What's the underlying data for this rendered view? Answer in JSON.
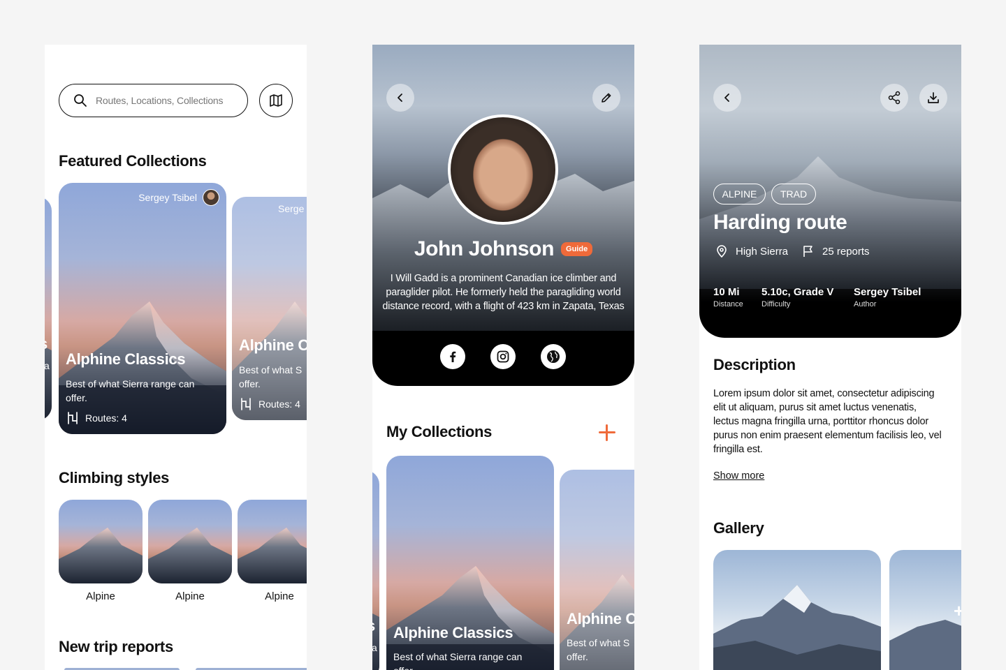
{
  "screen1": {
    "search_placeholder": "Routes, Locations, Collections",
    "featured_title": "Featured Collections",
    "featured_cards": [
      {
        "author": "Sergey Tsibel",
        "title": "Alphine Classics",
        "desc": "Best of what Sierra range can offer.",
        "routes": "Routes: 4"
      },
      {
        "author": "Serge",
        "title": "Alphine C",
        "desc": "Best of what S offer.",
        "routes": "Routes: 4"
      }
    ],
    "left_peek": {
      "title": "s",
      "desc": "ca"
    },
    "styles_title": "Climbing styles",
    "styles": [
      "Alpine",
      "Alpine",
      "Alpine"
    ],
    "trips_title": "New trip reports"
  },
  "screen2": {
    "name": "John Johnson",
    "badge": "Guide",
    "bio": "I Will Gadd is a prominent Canadian ice climber and paraglider pilot. He formerly held the paragliding world distance record, with a flight of 423 km in Zapata, Texas",
    "collections_title": "My Collections",
    "cards": [
      {
        "title": "Alphine Classics",
        "desc": "Best of what Sierra range can offer."
      },
      {
        "title": "Alphine C",
        "desc": "Best of what S offer."
      }
    ],
    "left_peek": {
      "title": "s",
      "desc": "ca"
    }
  },
  "screen3": {
    "tags": [
      "ALPINE",
      "TRAD"
    ],
    "title": "Harding route",
    "location": "High Sierra",
    "reports": "25 reports",
    "stats": [
      {
        "value": "10 Mi",
        "label": "Distance"
      },
      {
        "value": "5.10c, Grade V",
        "label": "Difficulty"
      },
      {
        "value": "Sergey Tsibel",
        "label": "Author"
      }
    ],
    "description_title": "Description",
    "description": "Lorem ipsum dolor sit amet, consectetur adipiscing elit ut aliquam, purus sit amet luctus venenatis, lectus magna fringilla urna, porttitor rhoncus dolor purus non enim praesent elementum facilisis leo, vel fringilla est.",
    "show_more": "Show more",
    "gallery_title": "Gallery",
    "gallery_more": "+"
  },
  "colors": {
    "accent": "#ef6a3a",
    "background": "#f5f5f5",
    "text": "#111111"
  }
}
